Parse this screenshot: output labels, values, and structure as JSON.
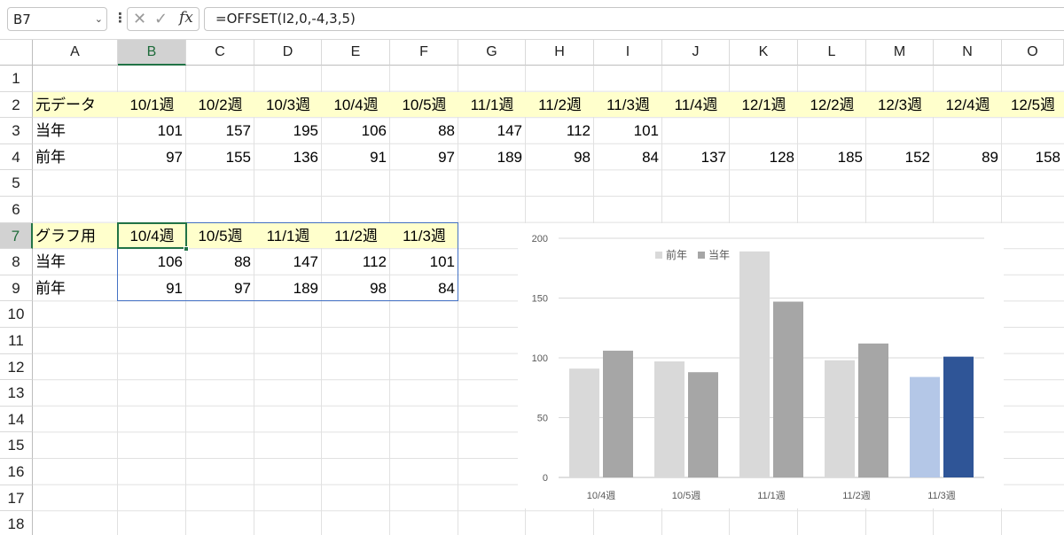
{
  "formula_bar": {
    "name_box": "B7",
    "name_box_arrow": "⌄",
    "dots": "⋮",
    "cancel_glyph": "✕",
    "enter_glyph": "✓",
    "fx_glyph": "fx",
    "formula": "=OFFSET(I2,0,-4,3,5)"
  },
  "columns": [
    "A",
    "B",
    "C",
    "D",
    "E",
    "F",
    "G",
    "H",
    "I",
    "J",
    "K",
    "L",
    "M",
    "N",
    "O"
  ],
  "selected_column": "B",
  "rows": [
    "1",
    "2",
    "3",
    "4",
    "5",
    "6",
    "7",
    "8",
    "9",
    "10",
    "11",
    "12",
    "13",
    "14",
    "15",
    "16",
    "17",
    "18"
  ],
  "selected_row": "7",
  "source_table": {
    "label": "元データ",
    "weeks": [
      "10/1週",
      "10/2週",
      "10/3週",
      "10/4週",
      "10/5週",
      "11/1週",
      "11/2週",
      "11/3週",
      "11/4週",
      "12/1週",
      "12/2週",
      "12/3週",
      "12/4週",
      "12/5週"
    ],
    "current_label": "当年",
    "current": [
      "101",
      "157",
      "195",
      "106",
      "88",
      "147",
      "112",
      "101"
    ],
    "previous_label": "前年",
    "previous": [
      "97",
      "155",
      "136",
      "91",
      "97",
      "189",
      "98",
      "84",
      "137",
      "128",
      "185",
      "152",
      "89",
      "158"
    ]
  },
  "graph_table": {
    "label": "グラフ用",
    "weeks": [
      "10/4週",
      "10/5週",
      "11/1週",
      "11/2週",
      "11/3週"
    ],
    "current_label": "当年",
    "current": [
      "106",
      "88",
      "147",
      "112",
      "101"
    ],
    "previous_label": "前年",
    "previous": [
      "91",
      "97",
      "189",
      "98",
      "84"
    ]
  },
  "chart_data": {
    "type": "bar",
    "categories": [
      "10/4週",
      "10/5週",
      "11/1週",
      "11/2週",
      "11/3週"
    ],
    "series": [
      {
        "name": "前年",
        "values": [
          91,
          97,
          189,
          98,
          84
        ],
        "color": "#d9d9d9",
        "last_color": "#b4c7e7"
      },
      {
        "name": "当年",
        "values": [
          106,
          88,
          147,
          112,
          101
        ],
        "color": "#a6a6a6",
        "last_color": "#2f5597"
      }
    ],
    "ylim": [
      0,
      200
    ],
    "yticks": [
      0,
      50,
      100,
      150,
      200
    ],
    "grid": true,
    "legend": "top-left",
    "title": "",
    "xlabel": "",
    "ylabel": ""
  },
  "colors": {
    "header_fill": "#ffffcc",
    "selection": "#217346",
    "range_border": "#4472c4"
  }
}
